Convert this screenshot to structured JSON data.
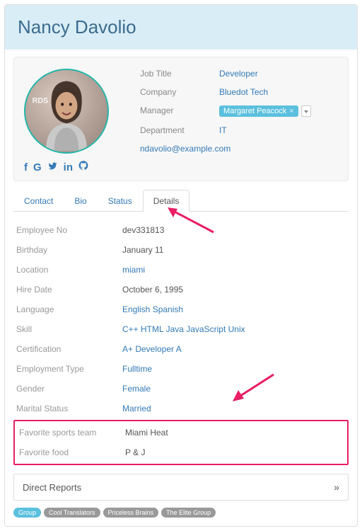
{
  "header": {
    "name": "Nancy Davolio"
  },
  "profile": {
    "rows": [
      {
        "label": "Job Title",
        "value": "Developer",
        "link": true
      },
      {
        "label": "Company",
        "value": "Bluedot Tech",
        "link": true
      },
      {
        "label": "Manager",
        "value": "Margaret Peacock",
        "chip": true
      },
      {
        "label": "Department",
        "value": "IT",
        "link": true
      }
    ],
    "email": "ndavolio@example.com",
    "avatar_badge_text": "RDS"
  },
  "social": [
    "facebook-icon",
    "google-icon",
    "twitter-icon",
    "linkedin-icon",
    "github-icon"
  ],
  "tabs": [
    {
      "label": "Contact",
      "active": false
    },
    {
      "label": "Bio",
      "active": false
    },
    {
      "label": "Status",
      "active": false
    },
    {
      "label": "Details",
      "active": true
    }
  ],
  "details": [
    {
      "label": "Employee No",
      "value": "dev331813",
      "link": false
    },
    {
      "label": "Birthday",
      "value": "January 11",
      "link": false
    },
    {
      "label": "Location",
      "value": "miami",
      "link": true
    },
    {
      "label": "Hire Date",
      "value": "October 6, 1995",
      "link": false
    },
    {
      "label": "Language",
      "value": "English Spanish",
      "link": true
    },
    {
      "label": "Skill",
      "value": "C++ HTML Java JavaScript Unix",
      "link": true
    },
    {
      "label": "Certification",
      "value": "A+ Developer A",
      "link": true
    },
    {
      "label": "Employment Type",
      "value": "Fulltime",
      "link": true
    },
    {
      "label": "Gender",
      "value": "Female",
      "link": true
    },
    {
      "label": "Marital Status",
      "value": "Married",
      "link": true
    }
  ],
  "highlight_rows": [
    {
      "label": "Favorite sports team",
      "value": "Miami Heat"
    },
    {
      "label": "Favorite food",
      "value": "P & J"
    }
  ],
  "direct_reports": {
    "label": "Direct Reports"
  },
  "badges": [
    {
      "label": "Group",
      "primary": true
    },
    {
      "label": "Cool Translators",
      "primary": false
    },
    {
      "label": "Priceless Brains",
      "primary": false
    },
    {
      "label": "The Elite Group",
      "primary": false
    }
  ],
  "annotation_color": "#e91e63"
}
